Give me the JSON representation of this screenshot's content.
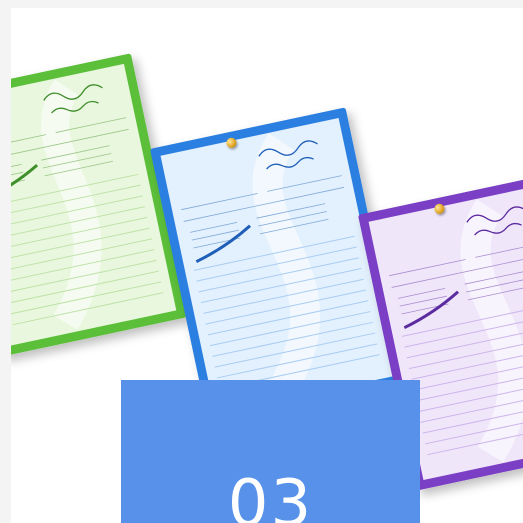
{
  "notes": [
    {
      "id": "green",
      "border": "#5cbf3a",
      "fill": "#e9f7df",
      "line": "#bfe3a8",
      "script": "#3f8f2a"
    },
    {
      "id": "blue",
      "border": "#2a7fe0",
      "fill": "#e3f0fd",
      "line": "#a9cdf3",
      "script": "#1f5fb8"
    },
    {
      "id": "purple",
      "border": "#7a3fc4",
      "fill": "#efe6fa",
      "line": "#cdb5ec",
      "script": "#5b2ba0"
    }
  ],
  "page_tile": {
    "color": "#5891ea",
    "number": "03"
  },
  "pin_color": "#e0a11a"
}
